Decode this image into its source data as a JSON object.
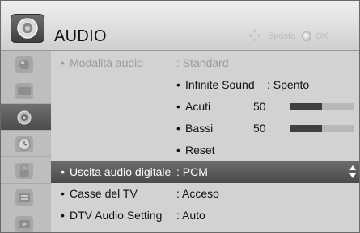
{
  "header": {
    "title": "AUDIO",
    "icon": "speaker-icon",
    "hints": {
      "move_label": "Sposta",
      "move_icon": "directional-pad-icon",
      "ok_label": "OK",
      "ok_icon": "ok-button-icon"
    }
  },
  "sidebar": {
    "items": [
      {
        "name": "picture",
        "icon": "picture-icon"
      },
      {
        "name": "screen",
        "icon": "screen-icon"
      },
      {
        "name": "audio",
        "icon": "speaker-icon",
        "active": true
      },
      {
        "name": "time",
        "icon": "clock-icon"
      },
      {
        "name": "lock",
        "icon": "lock-icon"
      },
      {
        "name": "option",
        "icon": "option-icon"
      }
    ]
  },
  "menu": {
    "items": [
      {
        "label": "Modalità audio",
        "value": ": Standard",
        "disabled": true
      },
      {
        "label": "Infinite Sound",
        "value": ": Spento"
      },
      {
        "label": "Acuti",
        "value": "50",
        "level": 0.5
      },
      {
        "label": "Bassi",
        "value": "50",
        "level": 0.5
      },
      {
        "label": "Reset",
        "value": ""
      },
      {
        "label": "Uscita audio digitale",
        "value": ": PCM",
        "selected": true
      },
      {
        "label": "Casse del TV",
        "value": ": Acceso"
      },
      {
        "label": "DTV Audio Setting",
        "value": ": Auto"
      }
    ],
    "bullet": "•"
  },
  "colors": {
    "highlight": "#555555",
    "bar_fill": "#3f3f3f",
    "bar_track": "#b8b8b8",
    "disabled_text": "#9a9a9a"
  }
}
